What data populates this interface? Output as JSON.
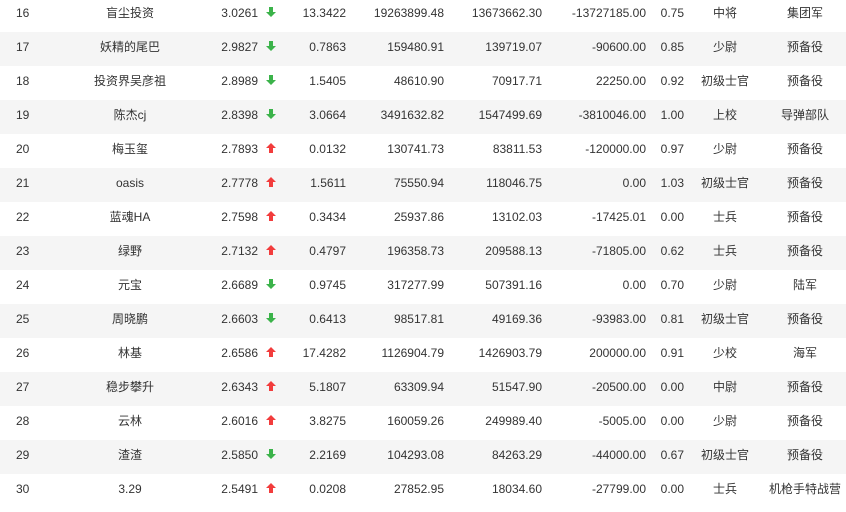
{
  "colors": {
    "up": "#f23c3c",
    "down": "#3bb34a",
    "alt_row": "#f5f5f5",
    "text": "#333333"
  },
  "rows": [
    {
      "rank": "16",
      "name": "盲尘投资",
      "score": "3.0261",
      "trend": "down",
      "v1": "13.3422",
      "v2": "19263899.48",
      "v3": "13673662.30",
      "v4": "-13727185.00",
      "v5": "0.75",
      "rank_title": "中将",
      "unit": "集团军"
    },
    {
      "rank": "17",
      "name": "妖精的尾巴",
      "score": "2.9827",
      "trend": "down",
      "v1": "0.7863",
      "v2": "159480.91",
      "v3": "139719.07",
      "v4": "-90600.00",
      "v5": "0.85",
      "rank_title": "少尉",
      "unit": "预备役"
    },
    {
      "rank": "18",
      "name": "投资界吴彦祖",
      "score": "2.8989",
      "trend": "down",
      "v1": "1.5405",
      "v2": "48610.90",
      "v3": "70917.71",
      "v4": "22250.00",
      "v5": "0.92",
      "rank_title": "初级士官",
      "unit": "预备役"
    },
    {
      "rank": "19",
      "name": "陈杰cj",
      "score": "2.8398",
      "trend": "down",
      "v1": "3.0664",
      "v2": "3491632.82",
      "v3": "1547499.69",
      "v4": "-3810046.00",
      "v5": "1.00",
      "rank_title": "上校",
      "unit": "导弹部队"
    },
    {
      "rank": "20",
      "name": "梅玉玺",
      "score": "2.7893",
      "trend": "up",
      "v1": "0.0132",
      "v2": "130741.73",
      "v3": "83811.53",
      "v4": "-120000.00",
      "v5": "0.97",
      "rank_title": "少尉",
      "unit": "预备役"
    },
    {
      "rank": "21",
      "name": "oasis",
      "score": "2.7778",
      "trend": "up",
      "v1": "1.5611",
      "v2": "75550.94",
      "v3": "118046.75",
      "v4": "0.00",
      "v5": "1.03",
      "rank_title": "初级士官",
      "unit": "预备役"
    },
    {
      "rank": "22",
      "name": "蓝魂HA",
      "score": "2.7598",
      "trend": "up",
      "v1": "0.3434",
      "v2": "25937.86",
      "v3": "13102.03",
      "v4": "-17425.01",
      "v5": "0.00",
      "rank_title": "士兵",
      "unit": "预备役"
    },
    {
      "rank": "23",
      "name": "绿野",
      "score": "2.7132",
      "trend": "up",
      "v1": "0.4797",
      "v2": "196358.73",
      "v3": "209588.13",
      "v4": "-71805.00",
      "v5": "0.62",
      "rank_title": "士兵",
      "unit": "预备役"
    },
    {
      "rank": "24",
      "name": "元宝",
      "score": "2.6689",
      "trend": "down",
      "v1": "0.9745",
      "v2": "317277.99",
      "v3": "507391.16",
      "v4": "0.00",
      "v5": "0.70",
      "rank_title": "少尉",
      "unit": "陆军"
    },
    {
      "rank": "25",
      "name": "周晓鹏",
      "score": "2.6603",
      "trend": "down",
      "v1": "0.6413",
      "v2": "98517.81",
      "v3": "49169.36",
      "v4": "-93983.00",
      "v5": "0.81",
      "rank_title": "初级士官",
      "unit": "预备役"
    },
    {
      "rank": "26",
      "name": "林基",
      "score": "2.6586",
      "trend": "up",
      "v1": "17.4282",
      "v2": "1126904.79",
      "v3": "1426903.79",
      "v4": "200000.00",
      "v5": "0.91",
      "rank_title": "少校",
      "unit": "海军"
    },
    {
      "rank": "27",
      "name": "稳步攀升",
      "score": "2.6343",
      "trend": "up",
      "v1": "5.1807",
      "v2": "63309.94",
      "v3": "51547.90",
      "v4": "-20500.00",
      "v5": "0.00",
      "rank_title": "中尉",
      "unit": "预备役"
    },
    {
      "rank": "28",
      "name": "云林",
      "score": "2.6016",
      "trend": "up",
      "v1": "3.8275",
      "v2": "160059.26",
      "v3": "249989.40",
      "v4": "-5005.00",
      "v5": "0.00",
      "rank_title": "少尉",
      "unit": "预备役"
    },
    {
      "rank": "29",
      "name": "渣渣",
      "score": "2.5850",
      "trend": "down",
      "v1": "2.2169",
      "v2": "104293.08",
      "v3": "84263.29",
      "v4": "-44000.00",
      "v5": "0.67",
      "rank_title": "初级士官",
      "unit": "预备役"
    },
    {
      "rank": "30",
      "name": "3.29",
      "score": "2.5491",
      "trend": "up",
      "v1": "0.0208",
      "v2": "27852.95",
      "v3": "18034.60",
      "v4": "-27799.00",
      "v5": "0.00",
      "rank_title": "士兵",
      "unit": "机枪手特战营"
    }
  ]
}
